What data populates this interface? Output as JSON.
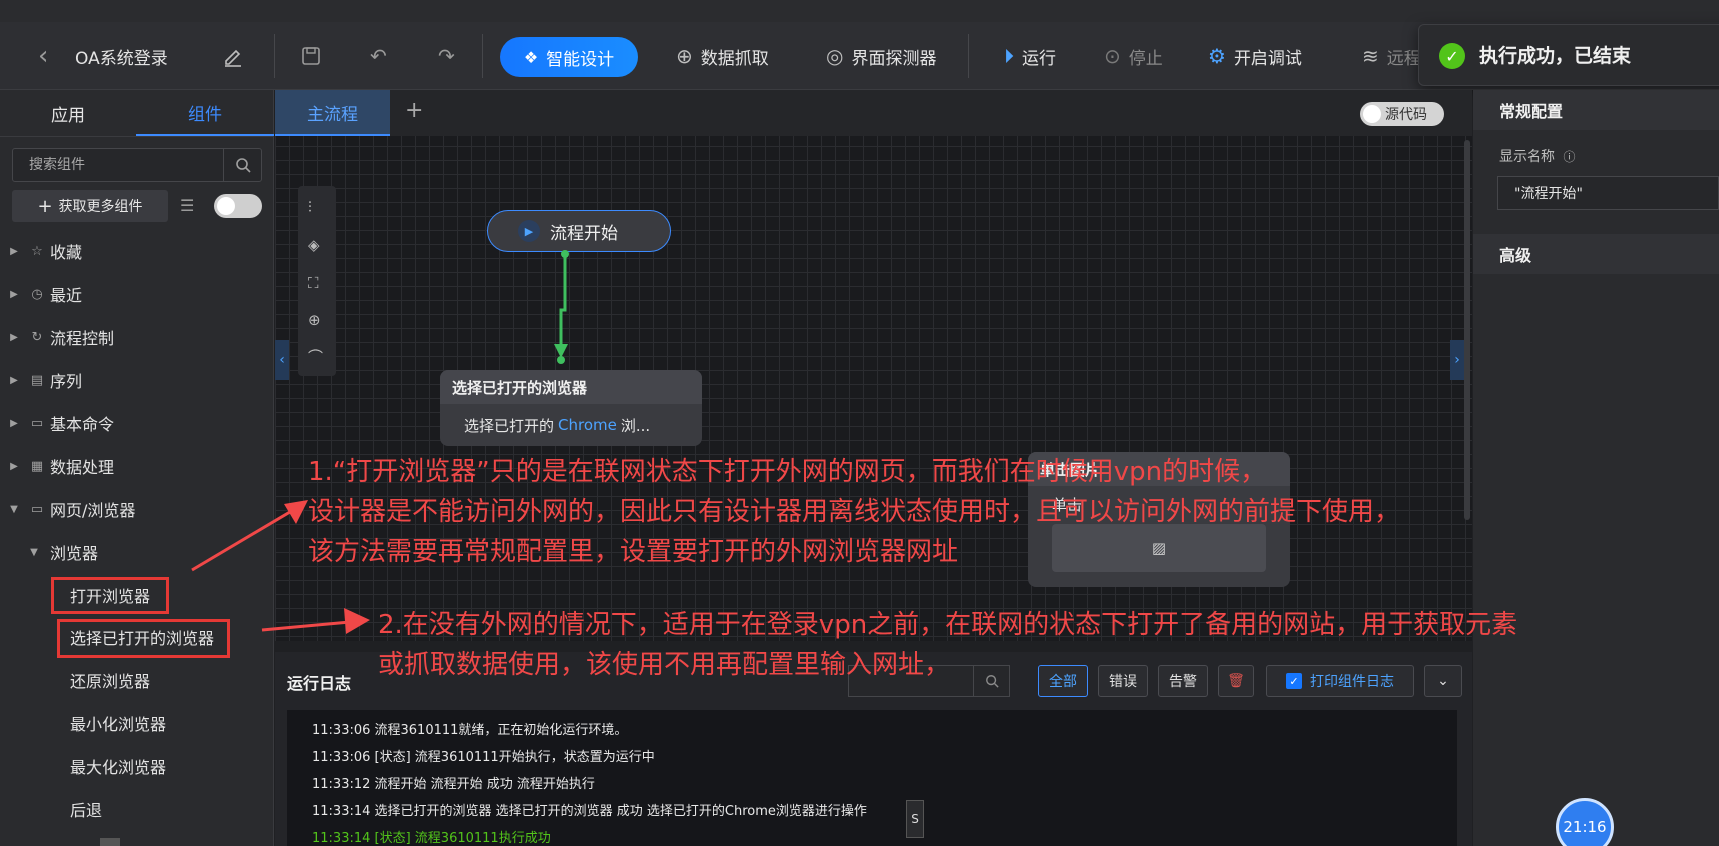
{
  "toolbar": {
    "title": "OA系统登录",
    "smart_design": "智能设计",
    "data_capture": "数据抓取",
    "detector": "界面探测器",
    "run": "运行",
    "stop": "停止",
    "debug": "开启调试",
    "remote": "远程"
  },
  "toast": {
    "text": "执行成功，已结束"
  },
  "left_panel": {
    "tab_app": "应用",
    "tab_components": "组件",
    "search_placeholder": "搜索组件",
    "get_more": "获取更多组件",
    "tree": [
      {
        "label": "收藏",
        "icon": "star-icon"
      },
      {
        "label": "最近",
        "icon": "clock-icon"
      },
      {
        "label": "流程控制",
        "icon": "flow-icon"
      },
      {
        "label": "序列",
        "icon": "list-icon"
      },
      {
        "label": "基本命令",
        "icon": "window-icon"
      },
      {
        "label": "数据处理",
        "icon": "data-icon"
      },
      {
        "label": "网页/浏览器",
        "icon": "browser-icon"
      }
    ],
    "sub_group": "浏览器",
    "sub_items": [
      "打开浏览器",
      "选择已打开的浏览器",
      "还原浏览器",
      "最小化浏览器",
      "最大化浏览器",
      "后退"
    ]
  },
  "canvas": {
    "tab_main": "主流程",
    "source_code": "源代码",
    "start_node": "流程开始",
    "node_title": "选择已打开的浏览器",
    "node_body_prefix": "选择已打开的",
    "node_body_chrome": "Chrome",
    "node_body_suffix": "浏...",
    "hidden_node_title": "单击图片",
    "hidden_node_body": "单击"
  },
  "right_panel": {
    "section_general": "常规配置",
    "display_name_label": "显示名称",
    "display_name_value": "\"流程开始\"",
    "section_advanced": "高级"
  },
  "log": {
    "title": "运行日志",
    "btn_all": "全部",
    "btn_error": "错误",
    "btn_warn": "告警",
    "print_log": "打印组件日志",
    "lines": [
      "11:33:06 流程3610111就绪，正在初始化运行环境。",
      "11:33:06 [状态] 流程3610111开始执行，状态置为运行中",
      "11:33:12 流程开始 流程开始 成功 流程开始执行",
      "11:33:14 选择已打开的浏览器 选择已打开的浏览器 成功 选择已打开的Chrome浏览器进行操作",
      "11:33:14 [状态] 流程3610111执行成功"
    ]
  },
  "annotations": {
    "note1_line1": "1.“打开浏览器”只的是在联网状态下打开外网的网页，而我们在时候用vpn的时候，",
    "note1_line2": "设计器是不能访问外网的，因此只有设计器用离线状态使用时，且可以访问外网的前提下使用，",
    "note1_line3": "该方法需要再常规配置里，设置要打开的外网浏览器网址",
    "note2_line1": "2.在没有外网的情况下，适用于在登录vpn之前，在联网的状态下打开了备用的网站，用于获取元素",
    "note2_line2": "或抓取数据使用，该使用不用再配置里输入网址，"
  },
  "clock": "21:16",
  "colors": {
    "accent": "#1677ff",
    "annotation": "#f04848",
    "success": "#52c41a",
    "flow_line": "#3fbf5f"
  }
}
